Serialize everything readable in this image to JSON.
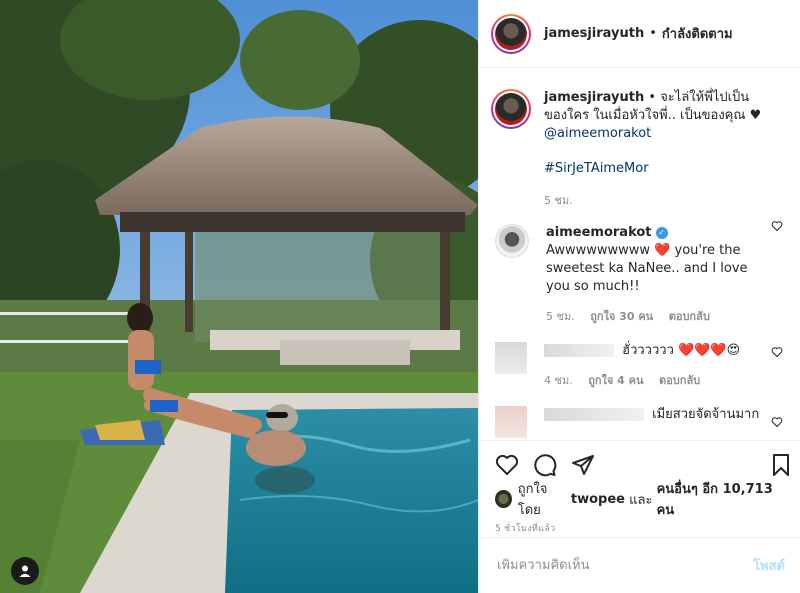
{
  "post": {
    "author": "jamesjirayuth",
    "follow_status": "กำลังติดตาม",
    "caption_text": "จะไล่ให้พี่ไปเป็นของใคร ในเมื่อหัวใจพี่.. เป็นของคุณ ♥",
    "caption_mention": "@aimeemorakot",
    "caption_hashtag": "#SirJeTAimeMor",
    "caption_time": "5 ชม."
  },
  "comments": [
    {
      "user": "aimeemorakot",
      "verified": true,
      "text": "Awwwwwwwww ❤️ you're the sweetest ka NaNee.. and I love you so much!!",
      "time": "5 ชม.",
      "likes": "ถูกใจ 30 คน",
      "reply": "ตอบกลับ"
    },
    {
      "user": "",
      "text": "ฮั่วววววว ❤️❤️❤️😍",
      "time": "4 ชม.",
      "likes": "ถูกใจ 4 คน",
      "reply": "ตอบกลับ"
    },
    {
      "user": "",
      "text": "เมียสวยจัดจ้านมาก"
    }
  ],
  "liked_by": {
    "prefix": "ถูกใจโดย",
    "user": "twopee",
    "mid": "และ",
    "others": "คนอื่นๆ อีก 10,713 คน"
  },
  "timestamp": "5 ชั่วโมงที่แล้ว",
  "add_comment": {
    "placeholder": "เพิ่มความคิดเห็น",
    "post_label": "โพสต์"
  },
  "icons": [
    "heart-icon",
    "comment-icon",
    "share-icon",
    "bookmark-icon",
    "user-tag-icon"
  ],
  "colors": {
    "link": "#00376b",
    "verified": "#3897f0",
    "post_disabled": "#b2dffc",
    "meta": "#8e8e8e"
  }
}
